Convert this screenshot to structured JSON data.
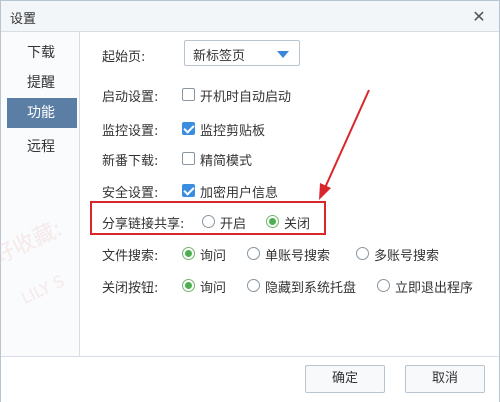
{
  "window": {
    "title": "设置",
    "close_glyph": "✕"
  },
  "sidebar": {
    "items": [
      {
        "label": "下载"
      },
      {
        "label": "提醒"
      },
      {
        "label": "功能"
      },
      {
        "label": "远程"
      }
    ],
    "active": "功能"
  },
  "settings": {
    "start_page": {
      "label": "起始页:",
      "value": "新标签页"
    },
    "startup": {
      "label": "启动设置:",
      "option": "开机时自动启动",
      "checked": false
    },
    "monitor": {
      "label": "监控设置:",
      "option": "监控剪贴板",
      "checked": true
    },
    "new_download": {
      "label": "新番下载:",
      "option": "精简模式",
      "checked": false
    },
    "security": {
      "label": "安全设置:",
      "option": "加密用户信息",
      "checked": true
    },
    "share_link": {
      "label": "分享链接共享:",
      "options": [
        "开启",
        "关闭"
      ],
      "selected": "关闭"
    },
    "file_search": {
      "label": "文件搜索:",
      "options": [
        "询问",
        "单账号搜索",
        "多账号搜索"
      ],
      "selected": "询问"
    },
    "close_button": {
      "label": "关闭按钮:",
      "options": [
        "询问",
        "隐藏到系统托盘",
        "立即退出程序"
      ],
      "selected": "询问"
    }
  },
  "footer": {
    "ok_label": "确定",
    "cancel_label": "取消"
  },
  "watermark": {
    "text": "好收藏:",
    "subtext": "LILY S"
  },
  "colors": {
    "accent": "#3a8ddf",
    "sidebar_active": "#5b7ea4",
    "annotation": "#d9262b",
    "radio_on": "#4caf50"
  }
}
